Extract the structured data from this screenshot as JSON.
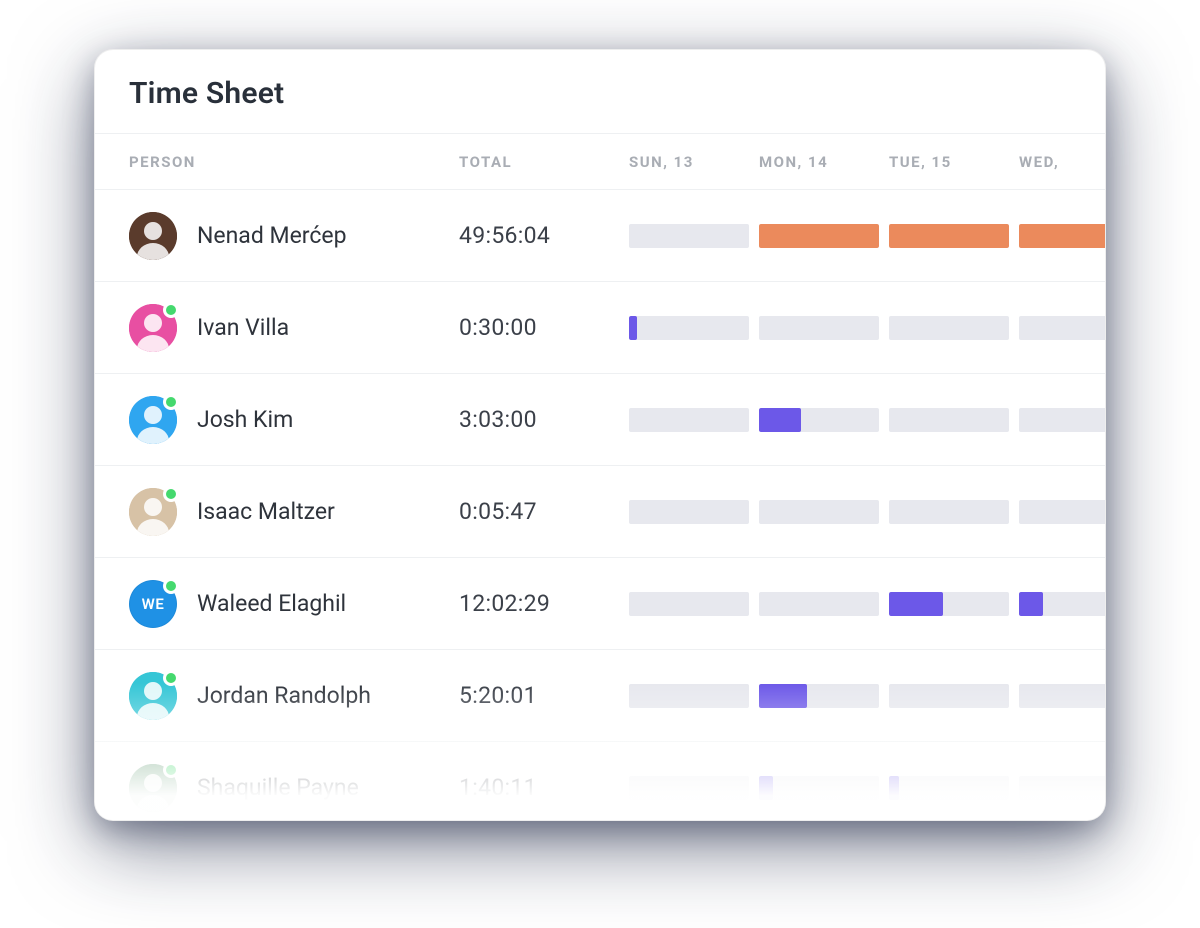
{
  "title": "Time Sheet",
  "columns": {
    "person": "Person",
    "total": "Total",
    "days": [
      "Sun, 13",
      "Mon, 14",
      "Tue, 15",
      "Wed,"
    ]
  },
  "colors": {
    "bar_bg": "#e7e8ee",
    "bar_orange": "#eb8a5c",
    "bar_purple": "#6c58e8",
    "presence": "#45d96e"
  },
  "rows": [
    {
      "name": "Nenad Merćep",
      "total": "49:56:04",
      "avatar": {
        "type": "photo",
        "bg": "#5a3b2c",
        "initials": ""
      },
      "online": false,
      "days": [
        {
          "fill": 0,
          "color": null
        },
        {
          "fill": 100,
          "color": "orange"
        },
        {
          "fill": 100,
          "color": "orange"
        },
        {
          "fill": 100,
          "color": "orange"
        }
      ]
    },
    {
      "name": "Ivan Villa",
      "total": "0:30:00",
      "avatar": {
        "type": "photo",
        "bg": "#e84fa2",
        "initials": ""
      },
      "online": true,
      "days": [
        {
          "fill": 7,
          "color": "purple"
        },
        {
          "fill": 0,
          "color": null
        },
        {
          "fill": 0,
          "color": null
        },
        {
          "fill": 0,
          "color": null
        }
      ]
    },
    {
      "name": "Josh Kim",
      "total": "3:03:00",
      "avatar": {
        "type": "photo",
        "bg": "#2fa6f0",
        "initials": ""
      },
      "online": true,
      "days": [
        {
          "fill": 0,
          "color": null
        },
        {
          "fill": 35,
          "color": "purple"
        },
        {
          "fill": 0,
          "color": null
        },
        {
          "fill": 0,
          "color": null
        }
      ]
    },
    {
      "name": "Isaac Maltzer",
      "total": "0:05:47",
      "avatar": {
        "type": "photo",
        "bg": "#d7c2a6",
        "initials": ""
      },
      "online": true,
      "days": [
        {
          "fill": 0,
          "color": null
        },
        {
          "fill": 0,
          "color": null
        },
        {
          "fill": 0,
          "color": null
        },
        {
          "fill": 0,
          "color": null
        }
      ]
    },
    {
      "name": "Waleed Elaghil",
      "total": "12:02:29",
      "avatar": {
        "type": "initials",
        "bg": "#1f91e5",
        "initials": "WE"
      },
      "online": true,
      "days": [
        {
          "fill": 0,
          "color": null
        },
        {
          "fill": 0,
          "color": null
        },
        {
          "fill": 45,
          "color": "purple"
        },
        {
          "fill": 20,
          "color": "purple"
        }
      ]
    },
    {
      "name": "Jordan Randolph",
      "total": "5:20:01",
      "avatar": {
        "type": "photo",
        "bg": "#35c6d6",
        "initials": ""
      },
      "online": true,
      "days": [
        {
          "fill": 0,
          "color": null
        },
        {
          "fill": 40,
          "color": "purple"
        },
        {
          "fill": 0,
          "color": null
        },
        {
          "fill": 0,
          "color": null
        }
      ]
    },
    {
      "name": "Shaquille Payne",
      "total": "1:40:11",
      "avatar": {
        "type": "photo",
        "bg": "#6aa07a",
        "initials": ""
      },
      "online": true,
      "days": [
        {
          "fill": 0,
          "color": null
        },
        {
          "fill": 12,
          "color": "purple"
        },
        {
          "fill": 8,
          "color": "purple"
        },
        {
          "fill": 0,
          "color": null
        }
      ]
    }
  ]
}
